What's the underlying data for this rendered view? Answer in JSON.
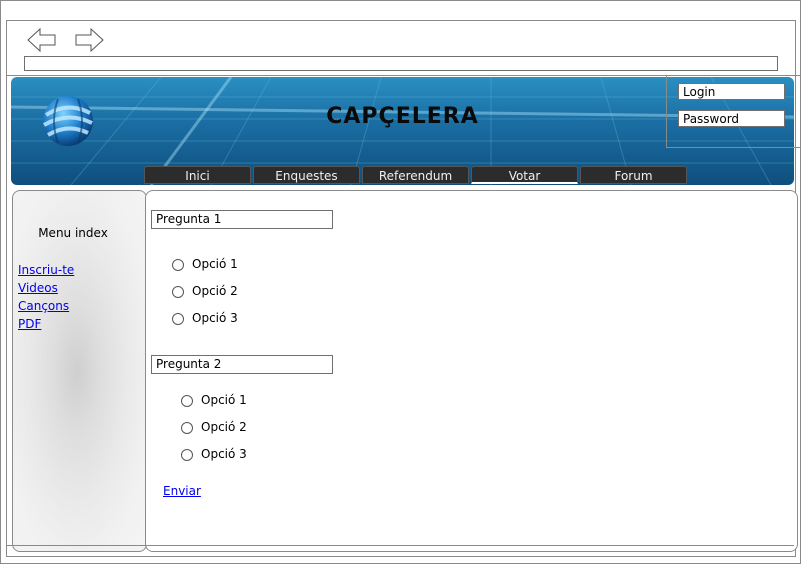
{
  "header": {
    "title": "CAPÇELERA"
  },
  "login": {
    "login_placeholder": "Login",
    "password_placeholder": "Password"
  },
  "menu": {
    "items": [
      "Inici",
      "Enquestes",
      "Referendum",
      "Votar",
      "Forum"
    ],
    "active": "Votar"
  },
  "sidebar": {
    "title": "Menu index",
    "links": [
      "Inscriu-te",
      "Videos",
      "Cançons",
      "PDF"
    ]
  },
  "questions": [
    {
      "label": "Pregunta 1",
      "options": [
        "Opció 1",
        "Opció 2",
        "Opció 3"
      ]
    },
    {
      "label": "Pregunta 2",
      "options": [
        "Opció 1",
        "Opció 2",
        "Opció 3"
      ]
    }
  ],
  "submit_label": "Enviar",
  "colors": {
    "header_top": "#2a8fc2",
    "header_bottom": "#0f4f7e",
    "menu_bg": "#2c2c2c",
    "link": "#0000ee"
  },
  "icons": {
    "back": "arrow-left-icon",
    "forward": "arrow-right-icon",
    "logo": "globe-logo-icon"
  }
}
